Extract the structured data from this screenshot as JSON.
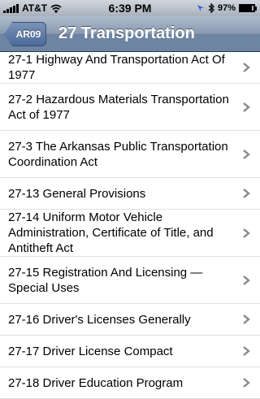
{
  "status_bar": {
    "carrier": "AT&T",
    "time": "6:39 PM",
    "battery_percent": "97%",
    "signal_icon": "signal-bars-icon",
    "wifi_icon": "wifi-icon",
    "location_icon": "location-arrow-icon",
    "bluetooth_icon": "bluetooth-icon",
    "battery_icon": "battery-icon"
  },
  "nav": {
    "back_label": "AR09",
    "title": "27 Transportation"
  },
  "list": {
    "items": [
      {
        "label": "27-1 Highway And Transportation Act Of 1977"
      },
      {
        "label": "27-2 Hazardous Materials Transportation Act of 1977"
      },
      {
        "label": "27-3 The Arkansas Public Transportation Coordination Act"
      },
      {
        "label": "27-13 General Provisions"
      },
      {
        "label": "27-14 Uniform Motor Vehicle Administration, Certificate of Title, and Antitheft Act"
      },
      {
        "label": "27-15 Registration And Licensing — Special Uses"
      },
      {
        "label": "27-16 Driver's Licenses Generally"
      },
      {
        "label": "27-17 Driver License Compact"
      },
      {
        "label": "27-18 Driver Education Program"
      }
    ]
  },
  "colors": {
    "nav_bar": "#6d84a2",
    "chevron": "#888888"
  }
}
